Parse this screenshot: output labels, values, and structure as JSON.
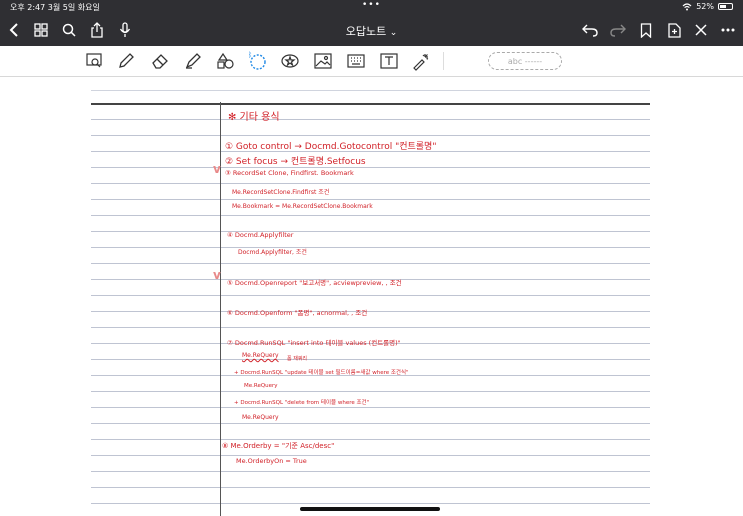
{
  "status": {
    "time_date": "오후 2:47   3월 5일 화요일",
    "battery_text": "52%",
    "battery_level_percent": 52
  },
  "navbar": {
    "title": "오답노트",
    "title_chevron": "⌄"
  },
  "toolbar": {
    "lasso_text_placeholder": "abc ------"
  },
  "notes": [
    {
      "text": "✻ 기타 용식"
    },
    {
      "text": "① Goto control → Docmd.Gotocontrol \"컨트롤명\""
    },
    {
      "text": "② Set focus → 컨트롤명.Setfocus"
    },
    {
      "text": "③ RecordSet Clone, Findfirst. Bookmark"
    },
    {
      "text": "Me.RecordSetClone.Findfirst 조건"
    },
    {
      "text": "Me.Bookmark = Me.RecordSetClone.Bookmark"
    },
    {
      "text": "④ Docmd.Applyfilter"
    },
    {
      "text": "Docmd.Applyfilter, 조건"
    },
    {
      "text": "⑤ Docmd.Openreport \"보고서명\", acviewpreview, , 조건"
    },
    {
      "text": "⑥ Docmd.Openform \"폼명\", acnormal, , 조건"
    },
    {
      "text": "⑦ Docmd.RunSQL \"insert into 테이블 values (컨트롤명)\""
    },
    {
      "text": "Me.ReQuery"
    },
    {
      "text": "폼 재쿼리"
    },
    {
      "text": "+ Docmd.RunSQL \"update 테이블 set 필드이름=새값 where 조건식\""
    },
    {
      "text": "Me.ReQuery"
    },
    {
      "text": "+ Docmd.RunSQL \"delete from 테이블 where 조건\""
    },
    {
      "text": "Me.ReQuery"
    },
    {
      "text": "⑧ Me.Orderby = \"기준 Asc/desc\""
    },
    {
      "text": "Me.OrderbyOn = True"
    }
  ],
  "colors": {
    "ink_red": "#d12128",
    "ui_dark": "#2f2f33",
    "page_line": "#bfc4d2"
  }
}
